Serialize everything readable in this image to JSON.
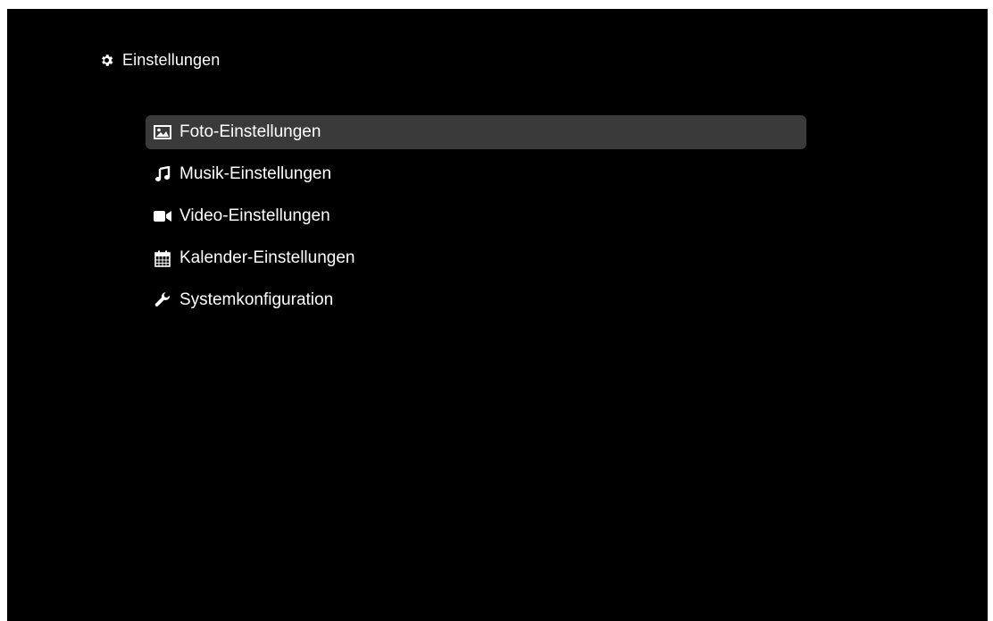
{
  "header": {
    "title": "Einstellungen",
    "icon": "gear-icon"
  },
  "menu": {
    "selected_index": 0,
    "items": [
      {
        "label": "Foto-Einstellungen",
        "icon": "image-icon"
      },
      {
        "label": "Musik-Einstellungen",
        "icon": "music-icon"
      },
      {
        "label": "Video-Einstellungen",
        "icon": "video-camera-icon"
      },
      {
        "label": "Kalender-Einstellungen",
        "icon": "calendar-icon"
      },
      {
        "label": "Systemkonfiguration",
        "icon": "wrench-icon"
      }
    ]
  },
  "colors": {
    "background": "#000000",
    "text": "#ffffff",
    "selection": "#3a3a3a"
  }
}
